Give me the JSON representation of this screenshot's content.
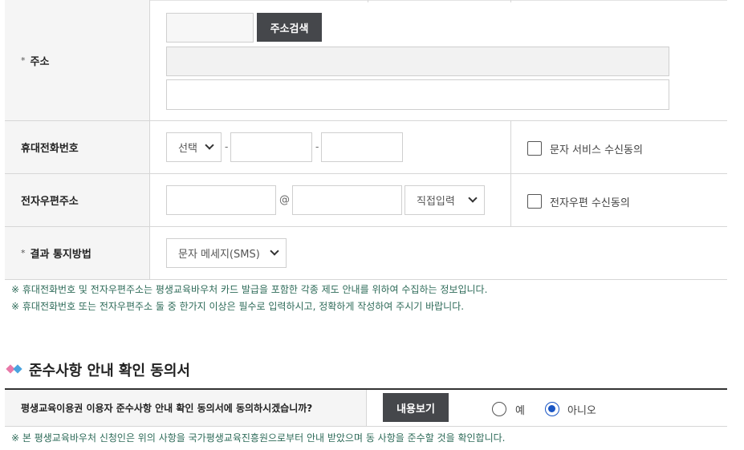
{
  "address": {
    "label": "주소",
    "search_button": "주소검색"
  },
  "mobile": {
    "label": "휴대전화번호",
    "carrier_select": "선택",
    "separator": "-",
    "sms_consent": "문자 서비스 수신동의"
  },
  "email": {
    "label": "전자우편주소",
    "at": "@",
    "domain_select": "직접입력",
    "email_consent": "전자우편 수신동의"
  },
  "notify": {
    "label": "결과 통지방법",
    "method_select": "문자 메세지(SMS)"
  },
  "required_mark": "*",
  "notes": [
    "※ 휴대전화번호 및 전자우편주소는 평생교육바우처 카드 발급을 포함한 각종 제도 안내를 위하여 수집하는 정보입니다.",
    "※ 휴대전화번호 또는 전자우편주소 둘 중 한가지 이상은 필수로 입력하시고, 정확하게 작성하여 주시기 바랍니다."
  ],
  "compliance": {
    "title": "준수사항 안내 확인 동의서",
    "question": "평생교육이용권 이용자 준수사항 안내 확인 동의서에 동의하시겠습니까?",
    "view_button": "내용보기",
    "option_yes": "예",
    "option_no": "아니오",
    "selected": "아니오",
    "note": "※ 본 평생교육바우처 신청인은 위의 사항을 국가평생교육진흥원으로부터 안내 받았으며 동 사항을 준수할 것을 확인합니다."
  },
  "colors": {
    "accent_pink": "#e879a8",
    "accent_blue": "#4aa3df",
    "note_text": "#2e6b59",
    "radio_selected": "#1a56c4",
    "button_dark": "#45474b"
  }
}
